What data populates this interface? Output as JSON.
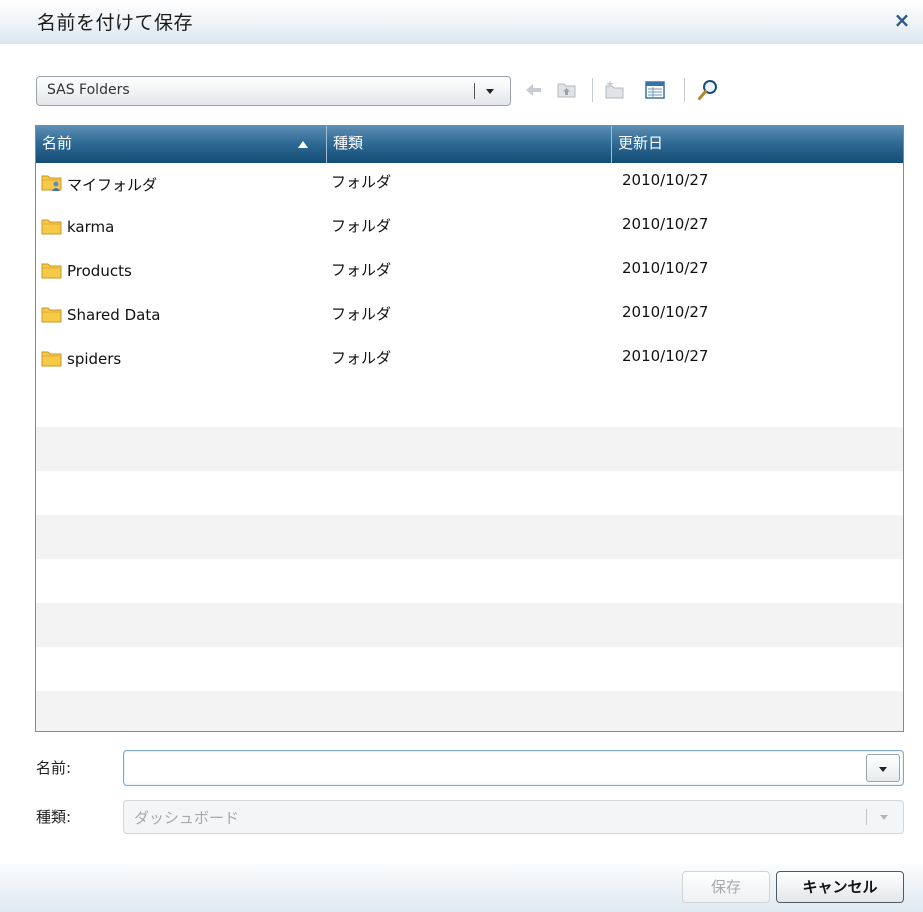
{
  "dialog": {
    "title": "名前を付けて保存",
    "close_label": "×"
  },
  "location": {
    "value": "SAS Folders"
  },
  "toolbar": {
    "icons": [
      "back-arrow-icon",
      "up-folder-icon",
      "new-folder-icon",
      "view-details-icon",
      "search-icon"
    ]
  },
  "table": {
    "columns": [
      "名前",
      "種類",
      "更新日"
    ],
    "sort": {
      "column": "名前",
      "direction": "ascending"
    },
    "rows": [
      {
        "name": "マイフォルダ",
        "type": "フォルダ",
        "date": "2010/10/27",
        "icon": "user-folder-icon"
      },
      {
        "name": "karma",
        "type": "フォルダ",
        "date": "2010/10/27",
        "icon": "folder-icon"
      },
      {
        "name": "Products",
        "type": "フォルダ",
        "date": "2010/10/27",
        "icon": "folder-icon"
      },
      {
        "name": "Shared Data",
        "type": "フォルダ",
        "date": "2010/10/27",
        "icon": "folder-icon"
      },
      {
        "name": "spiders",
        "type": "フォルダ",
        "date": "2010/10/27",
        "icon": "folder-icon"
      }
    ]
  },
  "form": {
    "name_label": "名前:",
    "name_value": "",
    "type_label": "種類:",
    "type_value": "ダッシュボード"
  },
  "buttons": {
    "save": "保存",
    "cancel": "キャンセル"
  },
  "colors": {
    "header_dark": "#144d76",
    "header_light": "#5e8eb3",
    "folder_yellow": "#f6c947",
    "close_blue": "#2a5a85"
  }
}
